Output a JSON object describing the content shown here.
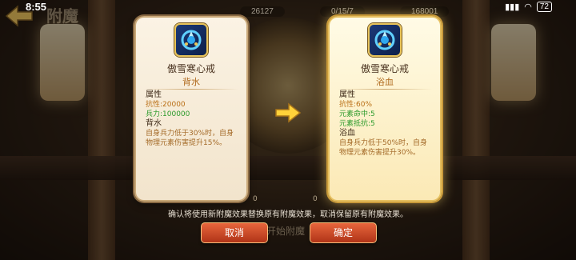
{
  "status_bar": {
    "time": "8:55",
    "battery": "72"
  },
  "top_resources": {
    "res1": "26127",
    "res2": "0/15/7",
    "res3": "168001"
  },
  "background": {
    "title": "附魔",
    "start_button": "开始附魔",
    "res_left_count": "0",
    "res_right_count": "0"
  },
  "left_card": {
    "item_name": "傲雪寒心戒",
    "enchant_name": "背水",
    "attr_title": "属性",
    "stats": [
      {
        "text": "抗性:20000",
        "color": "orange"
      },
      {
        "text": "兵力:100000",
        "color": "green"
      }
    ],
    "effect_title": "背水",
    "effect_desc": "自身兵力低于30%时，自身物理元素伤害提升15%。"
  },
  "right_card": {
    "item_name": "傲雪寒心戒",
    "enchant_name": "浴血",
    "attr_title": "属性",
    "stats": [
      {
        "text": "抗性:60%",
        "color": "orange"
      },
      {
        "text": "元素命中:5",
        "color": "green"
      },
      {
        "text": "元素抵抗:5",
        "color": "green"
      }
    ],
    "effect_title": "浴血",
    "effect_desc": "自身兵力低于50%时，自身物理元素伤害提升30%。"
  },
  "notice": "确认将使用新附魔效果替换原有附魔效果，取消保留原有附魔效果。",
  "buttons": {
    "cancel": "取消",
    "confirm": "确定"
  },
  "icons": {
    "item": "ring-crystal-icon",
    "arrow": "right-arrow-icon"
  },
  "colors": {
    "accent_orange": "#b96e14",
    "accent_green": "#2a9a2a",
    "button_red": "#c84424"
  }
}
